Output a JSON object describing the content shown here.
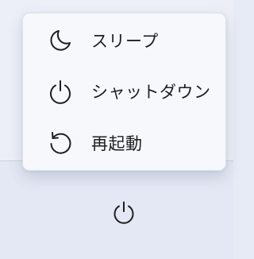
{
  "power_menu": {
    "items": [
      {
        "label": "スリープ",
        "icon": "moon-icon"
      },
      {
        "label": "シャットダウン",
        "icon": "power-icon"
      },
      {
        "label": "再起動",
        "icon": "restart-icon"
      }
    ]
  },
  "taskbar": {
    "power_button_icon": "power-icon"
  },
  "colors": {
    "menu_background": "#f6f8fc",
    "page_background": "#eceff7",
    "text": "#1f1f1f",
    "icon_stroke": "#1f1f1f"
  }
}
